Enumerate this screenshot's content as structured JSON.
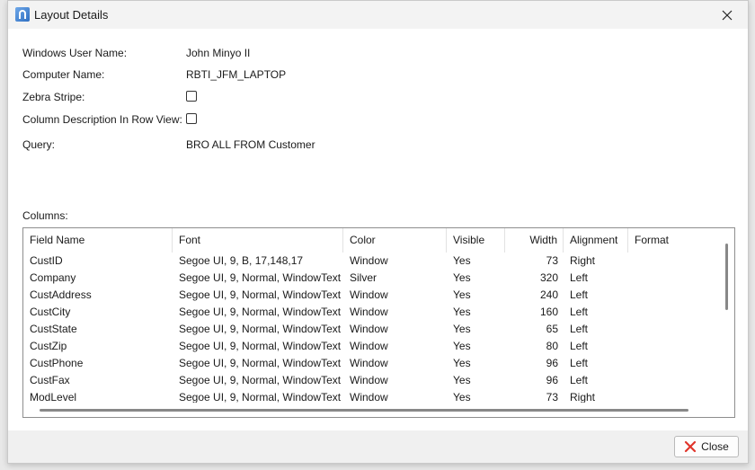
{
  "window": {
    "title": "Layout Details"
  },
  "fields": {
    "user_label": "Windows User Name:",
    "user_value": "John Minyo II",
    "computer_label": "Computer Name:",
    "computer_value": "RBTI_JFM_LAPTOP",
    "zebra_label": "Zebra Stripe:",
    "zebra_checked": false,
    "coldesc_label": "Column Description In Row View:",
    "coldesc_checked": false,
    "query_label": "Query:",
    "query_value": "BRO ALL FROM Customer",
    "columns_label": "Columns:"
  },
  "grid": {
    "headers": [
      "Field Name",
      "Font",
      "Color",
      "Visible",
      "Width",
      "Alignment",
      "Format"
    ],
    "rows": [
      [
        "CustID",
        "Segoe UI, 9, B, 17,148,17",
        "Window",
        "Yes",
        "73",
        "Right",
        ""
      ],
      [
        "Company",
        "Segoe UI, 9, Normal, WindowText",
        "Silver",
        "Yes",
        "320",
        "Left",
        ""
      ],
      [
        "CustAddress",
        "Segoe UI, 9, Normal, WindowText",
        "Window",
        "Yes",
        "240",
        "Left",
        ""
      ],
      [
        "CustCity",
        "Segoe UI, 9, Normal, WindowText",
        "Window",
        "Yes",
        "160",
        "Left",
        ""
      ],
      [
        "CustState",
        "Segoe UI, 9, Normal, WindowText",
        "Window",
        "Yes",
        "65",
        "Left",
        ""
      ],
      [
        "CustZip",
        "Segoe UI, 9, Normal, WindowText",
        "Window",
        "Yes",
        "80",
        "Left",
        ""
      ],
      [
        "CustPhone",
        "Segoe UI, 9, Normal, WindowText",
        "Window",
        "Yes",
        "96",
        "Left",
        ""
      ],
      [
        "CustFax",
        "Segoe UI, 9, Normal, WindowText",
        "Window",
        "Yes",
        "96",
        "Left",
        ""
      ],
      [
        "ModLevel",
        "Segoe UI, 9, Normal, WindowText",
        "Window",
        "Yes",
        "73",
        "Right",
        ""
      ]
    ]
  },
  "footer": {
    "close_label": "Close"
  },
  "icons": {
    "app": "layout-app-icon",
    "close_window": "close-icon",
    "close_button": "red-x-icon"
  },
  "colors": {
    "close_icon_red": "#e0352b"
  }
}
